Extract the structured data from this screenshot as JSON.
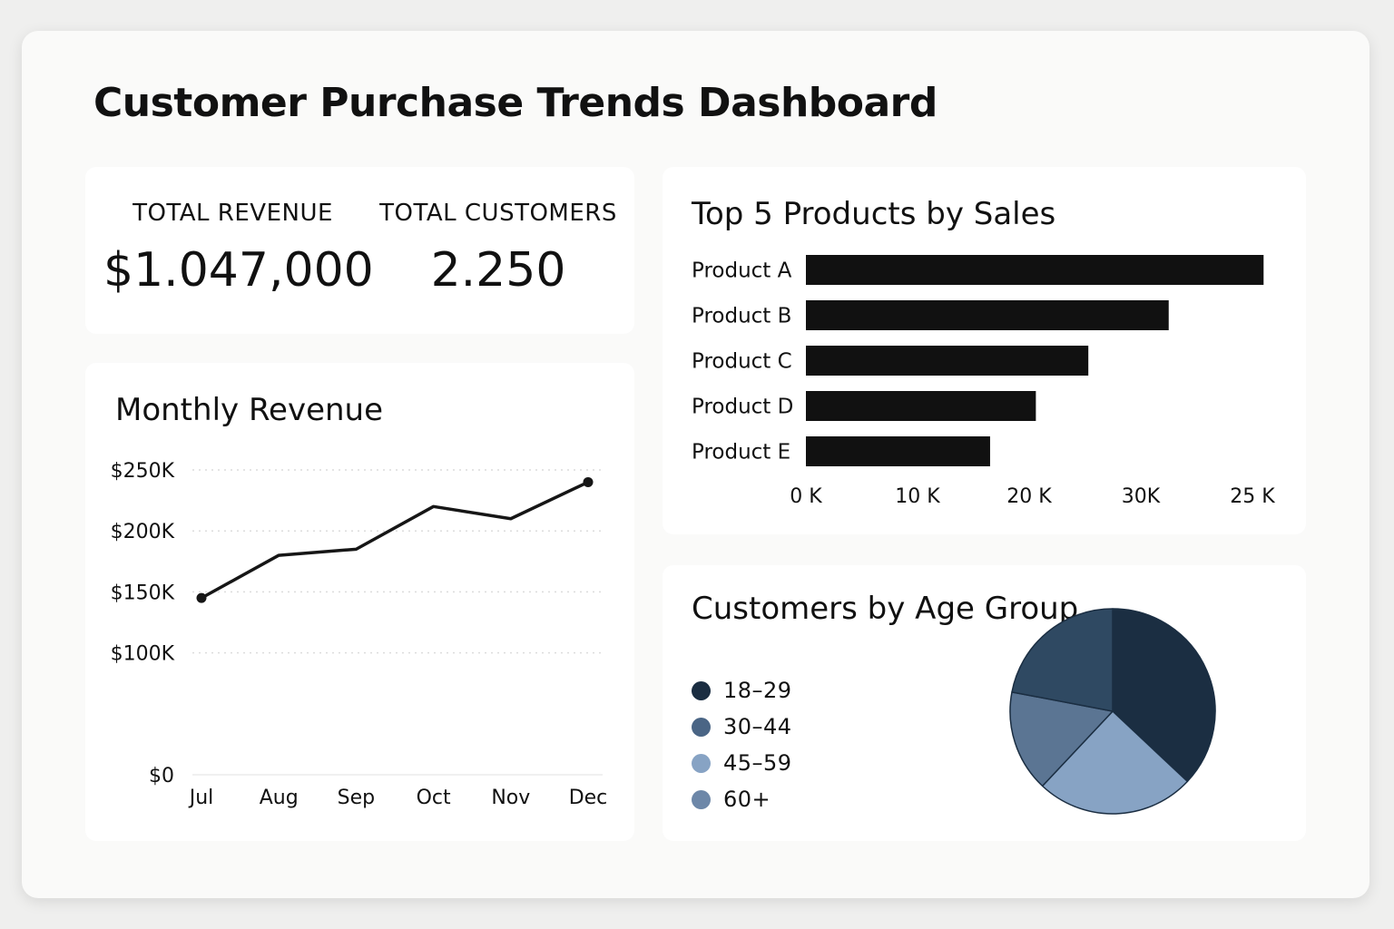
{
  "page": {
    "title": "Customer Purchase Trends Dashboard"
  },
  "kpis": {
    "revenue": {
      "label": "TOTAL REVENUE",
      "value": "$1.047,000"
    },
    "customers": {
      "label": "TOTAL CUSTOMERS",
      "value": "2.250"
    }
  },
  "chart_data": [
    {
      "type": "line",
      "title": "Monthly Revenue",
      "x": [
        "Jul",
        "Aug",
        "Sep",
        "Oct",
        "Nov",
        "Dec"
      ],
      "series": [
        {
          "values": [
            145000,
            180000,
            185000,
            220000,
            210000,
            240000
          ],
          "color": "#161616"
        }
      ],
      "yticks": [
        0,
        100000,
        150000,
        200000,
        250000
      ],
      "ytick_labels": [
        "$0",
        "$100K",
        "$150K",
        "$200K",
        "$250K"
      ],
      "ylim": [
        0,
        250000
      ],
      "grid": "dotted horizontal",
      "markers": "first and last point"
    },
    {
      "type": "bar",
      "orientation": "horizontal",
      "title": "Top 5 Products by Sales",
      "categories": [
        "Product A",
        "Product B",
        "Product C",
        "Product D",
        "Product E"
      ],
      "values": [
        41000,
        32500,
        25300,
        20600,
        16500
      ],
      "xtick_labels": [
        "0 K",
        "10 K",
        "20 K",
        "30K",
        "25 K"
      ],
      "xtick_positions": [
        0,
        10000,
        20000,
        30000,
        40000
      ],
      "xlim": [
        0,
        40000
      ],
      "color": "#111111"
    },
    {
      "type": "pie",
      "title": "Customers by Age Group",
      "categories": [
        "18–29",
        "30–44",
        "45–59",
        "60+"
      ],
      "values": [
        37,
        25,
        16,
        22
      ],
      "slice_colors": [
        "#1b2e42",
        "#87a3c4",
        "#5b7593",
        "#2f4962"
      ],
      "legend_colors": [
        "#1b2e42",
        "#4a6585",
        "#87a3c4",
        "#6d87a8"
      ],
      "legend_placement": "left"
    }
  ]
}
